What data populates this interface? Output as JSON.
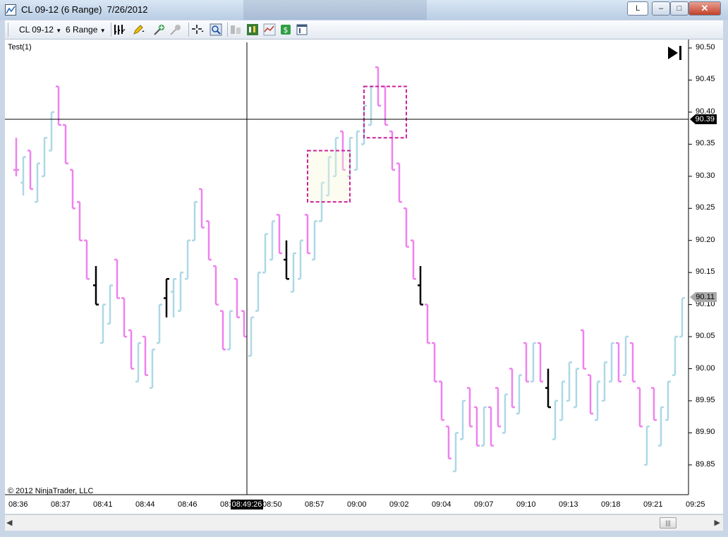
{
  "window": {
    "title": "CL 09-12 (6 Range)  7/26/2012",
    "btn_l": "L",
    "btn_min": "–",
    "btn_max": "□",
    "btn_close": "✕"
  },
  "toolbar": {
    "instrument": "CL 09-12",
    "period": "6 Range",
    "icons": [
      "bar-style-icon",
      "pencil-draw-icon",
      "add-indicator-icon",
      "strategy-icon",
      "crosshair-icon",
      "zoom-icon",
      "data-box-icon",
      "chart-trader-icon",
      "performance-icon",
      "dollar-icon",
      "properties-icon"
    ]
  },
  "chart": {
    "study_label": "Test(1)",
    "copyright": "© 2012 NinjaTrader, LLC",
    "go_to_end_icon": "▶|",
    "y_tick_labels": [
      "90.50",
      "90.45",
      "90.40",
      "90.35",
      "90.30",
      "90.25",
      "90.20",
      "90.15",
      "90.10",
      "90.05",
      "90.00",
      "89.95",
      "89.90",
      "89.85"
    ],
    "x_tick_labels": [
      "08:36",
      "08:37",
      "08:41",
      "08:44",
      "08:46",
      "08:",
      "08:50",
      "08:57",
      "09:00",
      "09:02",
      "09:04",
      "09:07",
      "09:10",
      "09:13",
      "09:18",
      "09:21",
      "09:25"
    ],
    "crosshair_price": "90.39",
    "crosshair_time": "08:49:26",
    "last_price": "90.11",
    "colors": {
      "up": "#add8e6",
      "down": "#ee82ee",
      "neutral": "#000000",
      "box": "#cc2299",
      "crosshair": "#000000"
    }
  },
  "chart_data": {
    "type": "bar",
    "ylim": [
      89.815,
      90.51
    ],
    "y_ticks": [
      90.5,
      90.45,
      90.4,
      90.35,
      90.3,
      90.25,
      90.2,
      90.15,
      90.1,
      90.05,
      90.0,
      89.95,
      89.9,
      89.85
    ],
    "bars": [
      {
        "x": 23,
        "o": 90.31,
        "h": 90.36,
        "l": 90.3,
        "c": 90.31,
        "d": "down"
      },
      {
        "x": 33,
        "o": 90.29,
        "h": 90.33,
        "l": 90.27,
        "c": 90.33,
        "d": "up"
      },
      {
        "x": 43,
        "o": 90.34,
        "h": 90.34,
        "l": 90.28,
        "c": 90.28,
        "d": "down"
      },
      {
        "x": 53,
        "o": 90.26,
        "h": 90.32,
        "l": 90.26,
        "c": 90.32,
        "d": "up"
      },
      {
        "x": 63,
        "o": 90.3,
        "h": 90.36,
        "l": 90.3,
        "c": 90.36,
        "d": "up"
      },
      {
        "x": 73,
        "o": 90.34,
        "h": 90.4,
        "l": 90.34,
        "c": 90.4,
        "d": "up"
      },
      {
        "x": 83,
        "o": 90.44,
        "h": 90.44,
        "l": 90.38,
        "c": 90.38,
        "d": "down"
      },
      {
        "x": 93,
        "o": 90.38,
        "h": 90.38,
        "l": 90.32,
        "c": 90.32,
        "d": "down"
      },
      {
        "x": 103,
        "o": 90.31,
        "h": 90.31,
        "l": 90.25,
        "c": 90.25,
        "d": "down"
      },
      {
        "x": 113,
        "o": 90.26,
        "h": 90.26,
        "l": 90.2,
        "c": 90.2,
        "d": "down"
      },
      {
        "x": 123,
        "o": 90.2,
        "h": 90.2,
        "l": 90.14,
        "c": 90.14,
        "d": "down"
      },
      {
        "x": 136,
        "o": 90.13,
        "h": 90.16,
        "l": 90.1,
        "c": 90.1,
        "d": "neutral"
      },
      {
        "x": 146,
        "o": 90.04,
        "h": 90.1,
        "l": 90.04,
        "c": 90.1,
        "d": "up"
      },
      {
        "x": 156,
        "o": 90.07,
        "h": 90.13,
        "l": 90.07,
        "c": 90.13,
        "d": "up"
      },
      {
        "x": 166,
        "o": 90.17,
        "h": 90.17,
        "l": 90.11,
        "c": 90.11,
        "d": "down"
      },
      {
        "x": 176,
        "o": 90.11,
        "h": 90.11,
        "l": 90.05,
        "c": 90.05,
        "d": "down"
      },
      {
        "x": 186,
        "o": 90.06,
        "h": 90.06,
        "l": 90.0,
        "c": 90.0,
        "d": "down"
      },
      {
        "x": 196,
        "o": 89.98,
        "h": 90.04,
        "l": 89.98,
        "c": 90.04,
        "d": "up"
      },
      {
        "x": 206,
        "o": 90.05,
        "h": 90.05,
        "l": 89.99,
        "c": 89.99,
        "d": "down"
      },
      {
        "x": 216,
        "o": 89.97,
        "h": 90.03,
        "l": 89.97,
        "c": 90.03,
        "d": "up"
      },
      {
        "x": 226,
        "o": 90.04,
        "h": 90.1,
        "l": 90.04,
        "c": 90.1,
        "d": "up"
      },
      {
        "x": 236,
        "o": 90.11,
        "h": 90.14,
        "l": 90.08,
        "c": 90.14,
        "d": "neutral"
      },
      {
        "x": 246,
        "o": 90.12,
        "h": 90.14,
        "l": 90.08,
        "c": 90.14,
        "d": "up"
      },
      {
        "x": 256,
        "o": 90.09,
        "h": 90.15,
        "l": 90.09,
        "c": 90.15,
        "d": "up"
      },
      {
        "x": 266,
        "o": 90.14,
        "h": 90.2,
        "l": 90.14,
        "c": 90.2,
        "d": "up"
      },
      {
        "x": 276,
        "o": 90.2,
        "h": 90.26,
        "l": 90.2,
        "c": 90.26,
        "d": "up"
      },
      {
        "x": 286,
        "o": 90.28,
        "h": 90.28,
        "l": 90.22,
        "c": 90.22,
        "d": "down"
      },
      {
        "x": 296,
        "o": 90.23,
        "h": 90.23,
        "l": 90.17,
        "c": 90.17,
        "d": "down"
      },
      {
        "x": 306,
        "o": 90.16,
        "h": 90.16,
        "l": 90.1,
        "c": 90.1,
        "d": "down"
      },
      {
        "x": 316,
        "o": 90.09,
        "h": 90.09,
        "l": 90.03,
        "c": 90.03,
        "d": "down"
      },
      {
        "x": 326,
        "o": 90.03,
        "h": 90.09,
        "l": 90.03,
        "c": 90.09,
        "d": "up"
      },
      {
        "x": 336,
        "o": 90.14,
        "h": 90.14,
        "l": 90.08,
        "c": 90.08,
        "d": "down"
      },
      {
        "x": 346,
        "o": 90.09,
        "h": 90.09,
        "l": 90.05,
        "c": 90.05,
        "d": "down"
      },
      {
        "x": 356,
        "o": 90.02,
        "h": 90.08,
        "l": 90.02,
        "c": 90.08,
        "d": "up"
      },
      {
        "x": 366,
        "o": 90.09,
        "h": 90.15,
        "l": 90.09,
        "c": 90.15,
        "d": "up"
      },
      {
        "x": 376,
        "o": 90.15,
        "h": 90.21,
        "l": 90.15,
        "c": 90.21,
        "d": "up"
      },
      {
        "x": 386,
        "o": 90.17,
        "h": 90.23,
        "l": 90.17,
        "c": 90.23,
        "d": "up"
      },
      {
        "x": 396,
        "o": 90.24,
        "h": 90.24,
        "l": 90.18,
        "c": 90.18,
        "d": "down"
      },
      {
        "x": 406,
        "o": 90.17,
        "h": 90.2,
        "l": 90.14,
        "c": 90.14,
        "d": "neutral"
      },
      {
        "x": 416,
        "o": 90.12,
        "h": 90.18,
        "l": 90.12,
        "c": 90.18,
        "d": "up"
      },
      {
        "x": 426,
        "o": 90.14,
        "h": 90.2,
        "l": 90.14,
        "c": 90.2,
        "d": "up"
      },
      {
        "x": 436,
        "o": 90.24,
        "h": 90.24,
        "l": 90.18,
        "c": 90.18,
        "d": "down"
      },
      {
        "x": 446,
        "o": 90.17,
        "h": 90.23,
        "l": 90.17,
        "c": 90.23,
        "d": "up"
      },
      {
        "x": 456,
        "o": 90.23,
        "h": 90.29,
        "l": 90.23,
        "c": 90.29,
        "d": "up"
      },
      {
        "x": 466,
        "o": 90.27,
        "h": 90.33,
        "l": 90.27,
        "c": 90.33,
        "d": "up"
      },
      {
        "x": 476,
        "o": 90.3,
        "h": 90.36,
        "l": 90.3,
        "c": 90.36,
        "d": "up"
      },
      {
        "x": 486,
        "o": 90.37,
        "h": 90.37,
        "l": 90.31,
        "c": 90.31,
        "d": "down"
      },
      {
        "x": 496,
        "o": 90.3,
        "h": 90.36,
        "l": 90.3,
        "c": 90.36,
        "d": "up"
      },
      {
        "x": 506,
        "o": 90.31,
        "h": 90.37,
        "l": 90.31,
        "c": 90.37,
        "d": "up"
      },
      {
        "x": 516,
        "o": 90.35,
        "h": 90.41,
        "l": 90.35,
        "c": 90.41,
        "d": "up"
      },
      {
        "x": 526,
        "o": 90.38,
        "h": 90.44,
        "l": 90.38,
        "c": 90.44,
        "d": "up"
      },
      {
        "x": 536,
        "o": 90.47,
        "h": 90.47,
        "l": 90.41,
        "c": 90.41,
        "d": "down"
      },
      {
        "x": 546,
        "o": 90.44,
        "h": 90.44,
        "l": 90.38,
        "c": 90.38,
        "d": "down"
      },
      {
        "x": 556,
        "o": 90.37,
        "h": 90.37,
        "l": 90.31,
        "c": 90.31,
        "d": "down"
      },
      {
        "x": 566,
        "o": 90.32,
        "h": 90.32,
        "l": 90.26,
        "c": 90.26,
        "d": "down"
      },
      {
        "x": 576,
        "o": 90.25,
        "h": 90.25,
        "l": 90.19,
        "c": 90.19,
        "d": "down"
      },
      {
        "x": 586,
        "o": 90.2,
        "h": 90.2,
        "l": 90.14,
        "c": 90.14,
        "d": "down"
      },
      {
        "x": 596,
        "o": 90.13,
        "h": 90.16,
        "l": 90.1,
        "c": 90.1,
        "d": "neutral"
      },
      {
        "x": 606,
        "o": 90.1,
        "h": 90.1,
        "l": 90.04,
        "c": 90.04,
        "d": "down"
      },
      {
        "x": 616,
        "o": 90.04,
        "h": 90.04,
        "l": 89.98,
        "c": 89.98,
        "d": "down"
      },
      {
        "x": 626,
        "o": 89.98,
        "h": 89.98,
        "l": 89.92,
        "c": 89.92,
        "d": "down"
      },
      {
        "x": 636,
        "o": 89.91,
        "h": 89.91,
        "l": 89.86,
        "c": 89.86,
        "d": "down"
      },
      {
        "x": 646,
        "o": 89.84,
        "h": 89.9,
        "l": 89.84,
        "c": 89.9,
        "d": "up"
      },
      {
        "x": 656,
        "o": 89.89,
        "h": 89.95,
        "l": 89.89,
        "c": 89.95,
        "d": "up"
      },
      {
        "x": 666,
        "o": 89.97,
        "h": 89.97,
        "l": 89.91,
        "c": 89.91,
        "d": "down"
      },
      {
        "x": 676,
        "o": 89.94,
        "h": 89.94,
        "l": 89.88,
        "c": 89.88,
        "d": "down"
      },
      {
        "x": 686,
        "o": 89.88,
        "h": 89.94,
        "l": 89.88,
        "c": 89.94,
        "d": "up"
      },
      {
        "x": 696,
        "o": 89.94,
        "h": 89.94,
        "l": 89.88,
        "c": 89.88,
        "d": "down"
      },
      {
        "x": 706,
        "o": 89.97,
        "h": 89.97,
        "l": 89.91,
        "c": 89.91,
        "d": "down"
      },
      {
        "x": 716,
        "o": 89.9,
        "h": 89.96,
        "l": 89.9,
        "c": 89.96,
        "d": "up"
      },
      {
        "x": 726,
        "o": 90.0,
        "h": 90.0,
        "l": 89.94,
        "c": 89.94,
        "d": "down"
      },
      {
        "x": 736,
        "o": 89.93,
        "h": 89.99,
        "l": 89.93,
        "c": 89.99,
        "d": "up"
      },
      {
        "x": 746,
        "o": 90.04,
        "h": 90.04,
        "l": 89.98,
        "c": 89.98,
        "d": "down"
      },
      {
        "x": 756,
        "o": 89.98,
        "h": 90.04,
        "l": 89.98,
        "c": 90.04,
        "d": "up"
      },
      {
        "x": 766,
        "o": 90.04,
        "h": 90.04,
        "l": 89.98,
        "c": 89.98,
        "d": "down"
      },
      {
        "x": 777,
        "o": 89.97,
        "h": 90.0,
        "l": 89.94,
        "c": 89.94,
        "d": "neutral"
      },
      {
        "x": 787,
        "o": 89.89,
        "h": 89.95,
        "l": 89.89,
        "c": 89.95,
        "d": "up"
      },
      {
        "x": 797,
        "o": 89.92,
        "h": 89.98,
        "l": 89.92,
        "c": 89.98,
        "d": "up"
      },
      {
        "x": 807,
        "o": 89.95,
        "h": 90.01,
        "l": 89.95,
        "c": 90.01,
        "d": "up"
      },
      {
        "x": 817,
        "o": 89.94,
        "h": 90.0,
        "l": 89.94,
        "c": 90.0,
        "d": "up"
      },
      {
        "x": 827,
        "o": 90.06,
        "h": 90.06,
        "l": 90.0,
        "c": 90.0,
        "d": "down"
      },
      {
        "x": 837,
        "o": 89.99,
        "h": 89.99,
        "l": 89.93,
        "c": 89.93,
        "d": "down"
      },
      {
        "x": 847,
        "o": 89.92,
        "h": 89.98,
        "l": 89.92,
        "c": 89.98,
        "d": "up"
      },
      {
        "x": 857,
        "o": 89.95,
        "h": 90.01,
        "l": 89.95,
        "c": 90.01,
        "d": "up"
      },
      {
        "x": 867,
        "o": 89.98,
        "h": 90.04,
        "l": 89.98,
        "c": 90.04,
        "d": "up"
      },
      {
        "x": 877,
        "o": 90.04,
        "h": 90.04,
        "l": 89.98,
        "c": 89.98,
        "d": "down"
      },
      {
        "x": 887,
        "o": 89.99,
        "h": 90.05,
        "l": 89.99,
        "c": 90.05,
        "d": "up"
      },
      {
        "x": 897,
        "o": 90.04,
        "h": 90.04,
        "l": 89.98,
        "c": 89.98,
        "d": "down"
      },
      {
        "x": 907,
        "o": 89.97,
        "h": 89.97,
        "l": 89.91,
        "c": 89.91,
        "d": "down"
      },
      {
        "x": 917,
        "o": 89.85,
        "h": 89.91,
        "l": 89.85,
        "c": 89.91,
        "d": "up"
      },
      {
        "x": 927,
        "o": 89.97,
        "h": 89.97,
        "l": 89.92,
        "c": 89.92,
        "d": "down"
      },
      {
        "x": 937,
        "o": 89.88,
        "h": 89.94,
        "l": 89.88,
        "c": 89.94,
        "d": "up"
      },
      {
        "x": 947,
        "o": 89.92,
        "h": 89.98,
        "l": 89.92,
        "c": 89.98,
        "d": "up"
      },
      {
        "x": 957,
        "o": 89.99,
        "h": 90.05,
        "l": 89.99,
        "c": 90.05,
        "d": "up"
      },
      {
        "x": 967,
        "o": 90.05,
        "h": 90.11,
        "l": 90.05,
        "c": 90.11,
        "d": "up"
      }
    ],
    "boxes": [
      {
        "x1": 436,
        "x2": 496,
        "top": 90.34,
        "bottom": 90.26
      },
      {
        "x1": 516,
        "x2": 576,
        "top": 90.44,
        "bottom": 90.36
      }
    ]
  }
}
